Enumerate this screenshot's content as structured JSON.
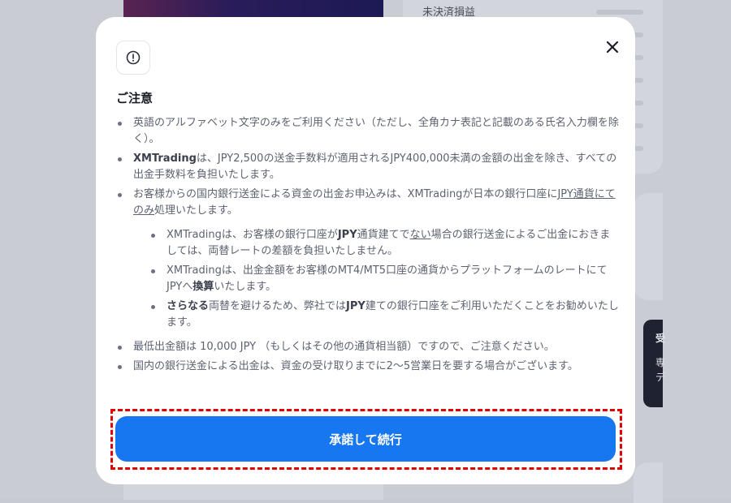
{
  "background": {
    "unrealized_pl_label": "未決済損益",
    "side_text_1": "受",
    "side_text_2": "専",
    "side_text_3": "デ"
  },
  "modal": {
    "title": "ご注意",
    "icons": {
      "alert": "alert-circle-icon",
      "close": "close-icon"
    },
    "items": {
      "i1": "英語のアルファベット文字のみをご利用ください（ただし、全角カナ表記と記載のある氏名入力欄を除く）。",
      "i2_bold": "XMTrading",
      "i2_text": "は、JPY2,500の送金手数料が適用されるJPY400,000未満の金額の出金を除き、すべての出金手数料を負担いたします。",
      "i3_text": "お客様からの国内銀行送金による資金の出金お申込みは、XMTradingが日本の銀行口座に",
      "i3_link": "JPY通貨にてのみ",
      "i3_tail": "処理いたします。",
      "s1_a": "XMTradingは、お客様の銀行口座が",
      "s1_bold": "JPY",
      "s1_b": "通貨建てで",
      "s1_u": "ない",
      "s1_c": "場合の銀行送金によるご出金におきましては、両替レートの差額を負担いたしません。",
      "s2_a": "XMTradingは、出金金額をお客様のMT4/MT5口座の通貨からプラットフォームのレートにてJPYへ",
      "s2_bold": "換算",
      "s2_b": "いたします。",
      "s3_bold": "さらなる",
      "s3_a": "両替を避けるため、弊社では",
      "s3_bold2": "JPY",
      "s3_b": "建ての銀行口座をご利用いただくことをお勧めいたします。",
      "i4": "最低出金額は 10,000 JPY （もしくはその他の通貨相当額）ですので、ご注意ください。",
      "i5": "国内の銀行送金による出金は、資金の受け取りまでに2〜5営業日を要する場合がございます。"
    },
    "accept_button": "承諾して続行"
  },
  "colors": {
    "primary": "#1677f0",
    "highlight_border": "#e00000",
    "title_text": "#1b1e26",
    "body_text": "#5d6270"
  }
}
